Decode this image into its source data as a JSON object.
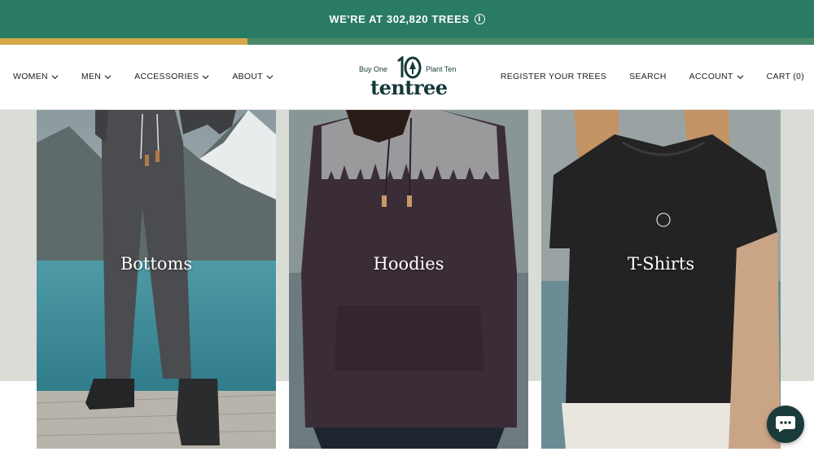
{
  "banner": {
    "text": "WE'RE AT 302,820 TREES",
    "info_icon": "info-icon",
    "progress": 0.304,
    "colors": {
      "bg": "#2a7b64",
      "progress_fill": "#d7a94a",
      "progress_track": "#4a8a6a"
    }
  },
  "header": {
    "nav_left": [
      {
        "label": "WOMEN"
      },
      {
        "label": "MEN"
      },
      {
        "label": "ACCESSORIES"
      },
      {
        "label": "ABOUT"
      }
    ],
    "logo": {
      "left_text": "Buy One",
      "number": "10",
      "right_text": "Plant Ten",
      "name": "tentree"
    },
    "nav_right": {
      "register": "REGISTER YOUR TREES",
      "search": "SEARCH",
      "account": "ACCOUNT",
      "cart": "CART (0)"
    }
  },
  "categories": [
    {
      "label": "Bottoms"
    },
    {
      "label": "Hoodies"
    },
    {
      "label": "T-Shirts"
    }
  ],
  "chat": {
    "icon": "chat-bubble-icon"
  }
}
